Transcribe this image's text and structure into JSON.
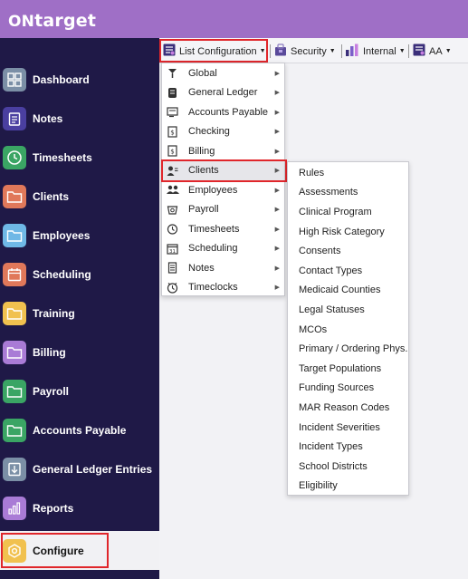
{
  "header": {
    "logo_on": "ON",
    "logo_target": "target",
    "brand_color": "#9f6fc6"
  },
  "sidebar": {
    "bg_color": "#1f1947",
    "items": [
      {
        "label": "Dashboard",
        "icon": "dashboard-icon",
        "color": "#7b8fa6"
      },
      {
        "label": "Notes",
        "icon": "notes-icon",
        "color": "#4a3fa0"
      },
      {
        "label": "Timesheets",
        "icon": "clock-icon",
        "color": "#3aa564"
      },
      {
        "label": "Clients",
        "icon": "folder-icon",
        "color": "#e0785a"
      },
      {
        "label": "Employees",
        "icon": "folder-icon",
        "color": "#6fb8e6"
      },
      {
        "label": "Scheduling",
        "icon": "calendar-icon",
        "color": "#e0785a"
      },
      {
        "label": "Training",
        "icon": "folder-icon",
        "color": "#f1c14f"
      },
      {
        "label": "Billing",
        "icon": "folder-icon",
        "color": "#a97bd6"
      },
      {
        "label": "Payroll",
        "icon": "folder-icon",
        "color": "#3aa564"
      },
      {
        "label": "Accounts Payable",
        "icon": "folder-icon",
        "color": "#3aa564"
      },
      {
        "label": "General Ledger Entries",
        "icon": "download-icon",
        "color": "#7b8fa6"
      },
      {
        "label": "Reports",
        "icon": "bar-chart-icon",
        "color": "#a97bd6"
      },
      {
        "label": "Configure",
        "icon": "gear-icon",
        "color": "#f1c14f"
      }
    ],
    "active": "Configure"
  },
  "menubar": {
    "items": [
      {
        "label": "List Configuration",
        "icon": "list-config-icon"
      },
      {
        "label": "Security",
        "icon": "security-icon"
      },
      {
        "label": "Internal",
        "icon": "internal-chart-icon"
      },
      {
        "label": "AA",
        "icon": "aa-icon"
      }
    ]
  },
  "list_config_menu": {
    "items": [
      {
        "label": "Global",
        "icon": "global-icon"
      },
      {
        "label": "General Ledger",
        "icon": "ledger-icon"
      },
      {
        "label": "Accounts Payable",
        "icon": "accounts-payable-icon"
      },
      {
        "label": "Checking",
        "icon": "checking-icon"
      },
      {
        "label": "Billing",
        "icon": "billing-icon"
      },
      {
        "label": "Clients",
        "icon": "clients-icon"
      },
      {
        "label": "Employees",
        "icon": "employees-icon"
      },
      {
        "label": "Payroll",
        "icon": "payroll-icon"
      },
      {
        "label": "Timesheets",
        "icon": "timesheets-icon"
      },
      {
        "label": "Scheduling",
        "icon": "scheduling-icon"
      },
      {
        "label": "Notes",
        "icon": "notes-icon"
      },
      {
        "label": "Timeclocks",
        "icon": "timeclocks-icon"
      }
    ],
    "highlighted": "Clients"
  },
  "clients_submenu": {
    "items": [
      "Rules",
      "Assessments",
      "Clinical Program",
      "High Risk Category",
      "Consents",
      "Contact Types",
      "Medicaid Counties",
      "Legal Statuses",
      "MCOs",
      "Primary / Ordering Phys.",
      "Target Populations",
      "Funding Sources",
      "MAR Reason Codes",
      "Incident Severities",
      "Incident Types",
      "School Districts",
      "Eligibility"
    ]
  },
  "highlight_color": "#e0262b"
}
